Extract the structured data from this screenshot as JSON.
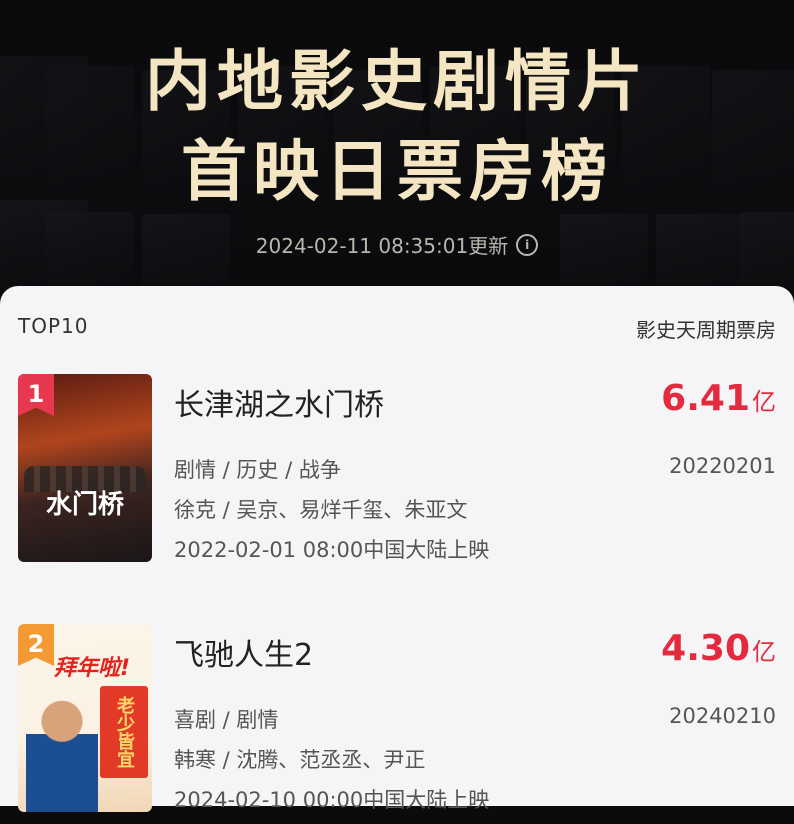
{
  "header": {
    "title_line1": "内地影史剧情片",
    "title_line2": "首映日票房榜",
    "update_time": "2024-02-11 08:35:01更新",
    "info_icon": "info-icon"
  },
  "list": {
    "tab_label": "TOP10",
    "title": "影史天周期票房",
    "items": [
      {
        "rank": "1",
        "name": "长津湖之水门桥",
        "box_value": "6.41",
        "box_unit": "亿",
        "genres": "剧情 / 历史 / 战争",
        "release_code": "20220201",
        "people": "徐克 / 吴京、易烊千玺、朱亚文",
        "release": "2022-02-01 08:00中国大陆上映",
        "cover_text": "水门桥"
      },
      {
        "rank": "2",
        "name": "飞驰人生2",
        "box_value": "4.30",
        "box_unit": "亿",
        "genres": "喜剧 / 剧情",
        "release_code": "20240210",
        "people": "韩寒 / 沈腾、范丞丞、尹正",
        "release": "2024-02-10 00:00中国大陆上映",
        "cover_text": "拜年啦!",
        "cover_sign": "老少皆宜"
      }
    ]
  },
  "colors": {
    "accent_red": "#e32a3f",
    "rank1": "#e8384f",
    "rank2": "#f39a35",
    "title_gold": "#f5e6c3"
  }
}
